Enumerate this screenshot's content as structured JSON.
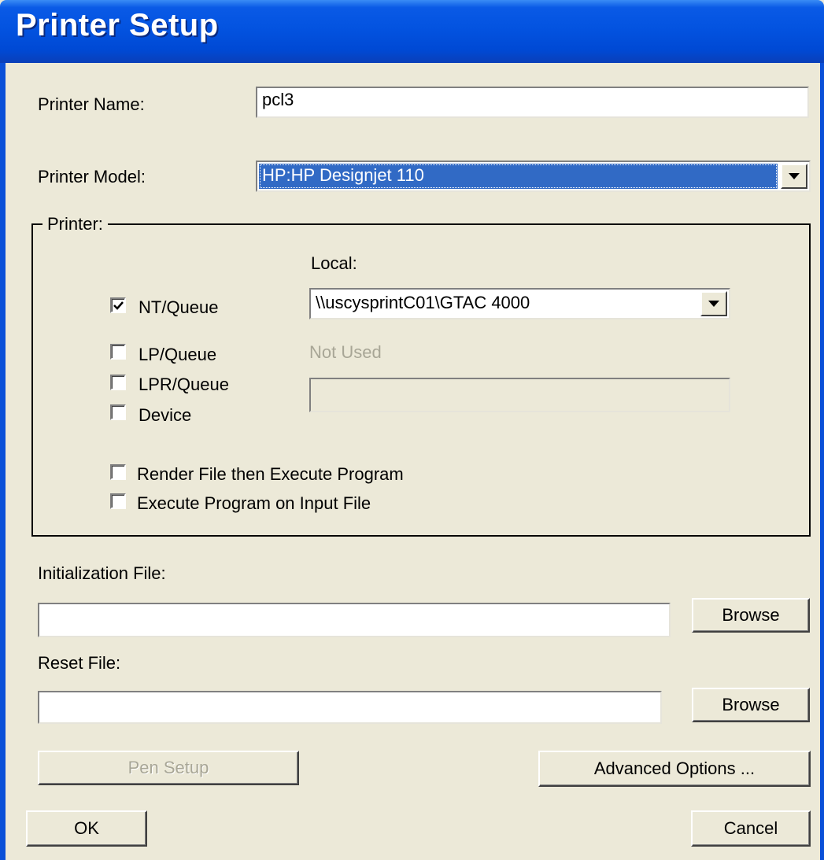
{
  "window": {
    "title": "Printer Setup"
  },
  "printer_name": {
    "label": "Printer Name:",
    "value": "pcl3"
  },
  "printer_model": {
    "label": "Printer Model:",
    "value": "HP:HP Designjet 110"
  },
  "printer_group": {
    "label": "Printer:",
    "local_label": "Local:",
    "local_value": "\\\\uscysprintC01\\GTAC 4000",
    "not_used_label": "Not Used",
    "not_used_value": "",
    "options": [
      {
        "label": "NT/Queue",
        "checked": true
      },
      {
        "label": "LP/Queue",
        "checked": false
      },
      {
        "label": "LPR/Queue",
        "checked": false
      },
      {
        "label": "Device",
        "checked": false
      },
      {
        "label": "Render File then Execute Program",
        "checked": false
      },
      {
        "label": "Execute Program on Input File",
        "checked": false
      }
    ]
  },
  "init_file": {
    "label": "Initialization File:",
    "value": "",
    "browse_label": "Browse"
  },
  "reset_file": {
    "label": "Reset File:",
    "value": "",
    "browse_label": "Browse"
  },
  "buttons": {
    "pen_setup": "Pen Setup",
    "advanced_options": "Advanced Options ...",
    "ok": "OK",
    "cancel": "Cancel"
  }
}
